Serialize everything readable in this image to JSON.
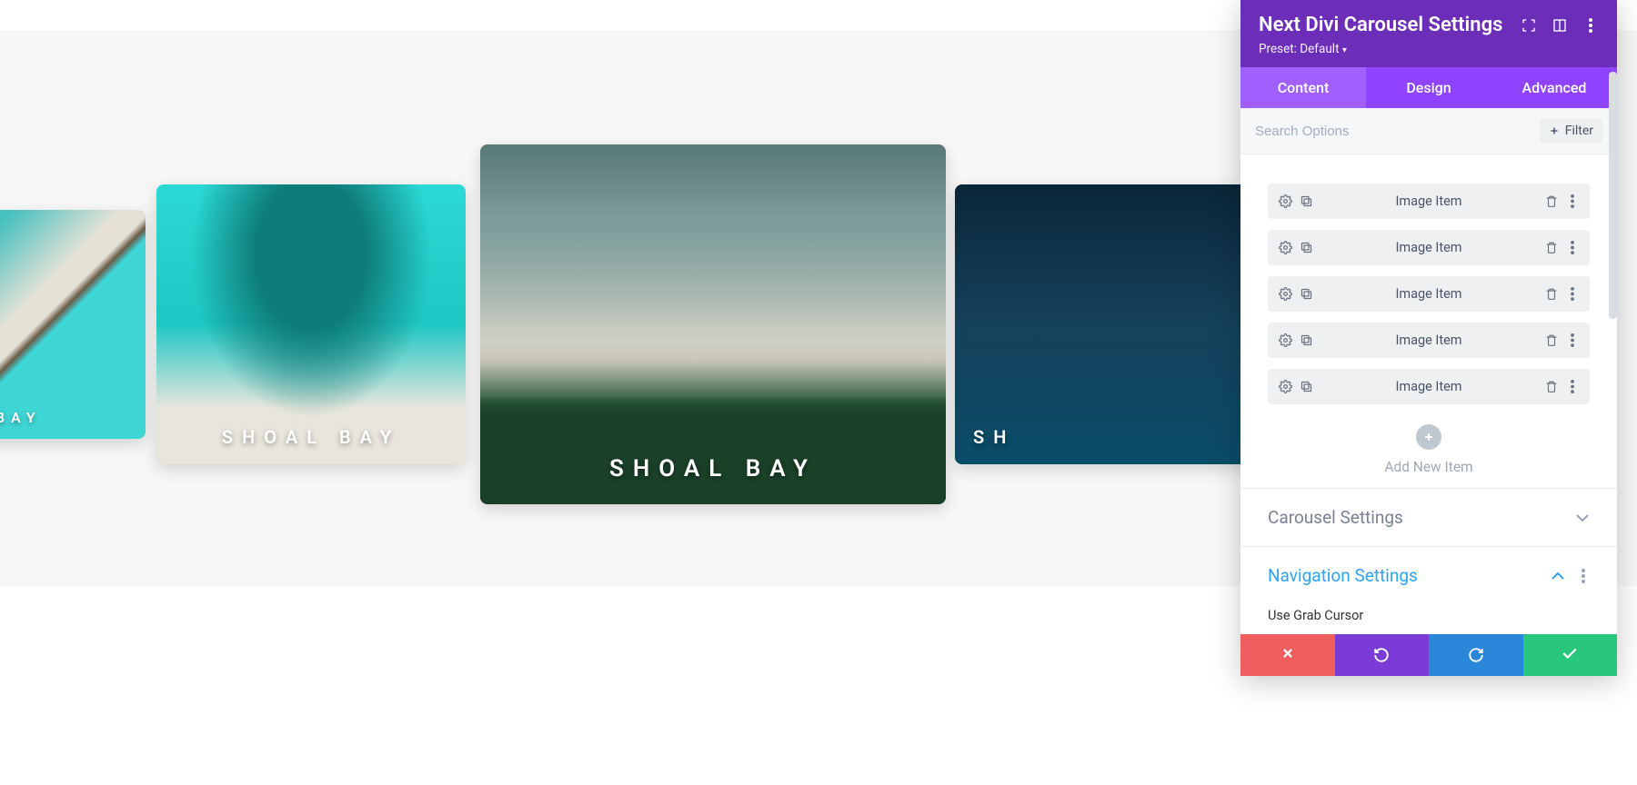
{
  "canvas": {
    "caption": "SHOAL BAY",
    "caption_partial_left": "HOAL BAY",
    "caption_partial_right": "SH"
  },
  "panel": {
    "title": "Next Divi Carousel Settings",
    "preset_label": "Preset: Default",
    "tabs": {
      "content": "Content",
      "design": "Design",
      "advanced": "Advanced"
    },
    "search_placeholder": "Search Options",
    "filter_label": "Filter",
    "items": [
      {
        "label": "Image Item"
      },
      {
        "label": "Image Item"
      },
      {
        "label": "Image Item"
      },
      {
        "label": "Image Item"
      },
      {
        "label": "Image Item"
      }
    ],
    "add_new_label": "Add New Item",
    "sections": {
      "carousel": "Carousel Settings",
      "navigation": "Navigation Settings",
      "navigation_option": "Use Grab Cursor"
    }
  }
}
